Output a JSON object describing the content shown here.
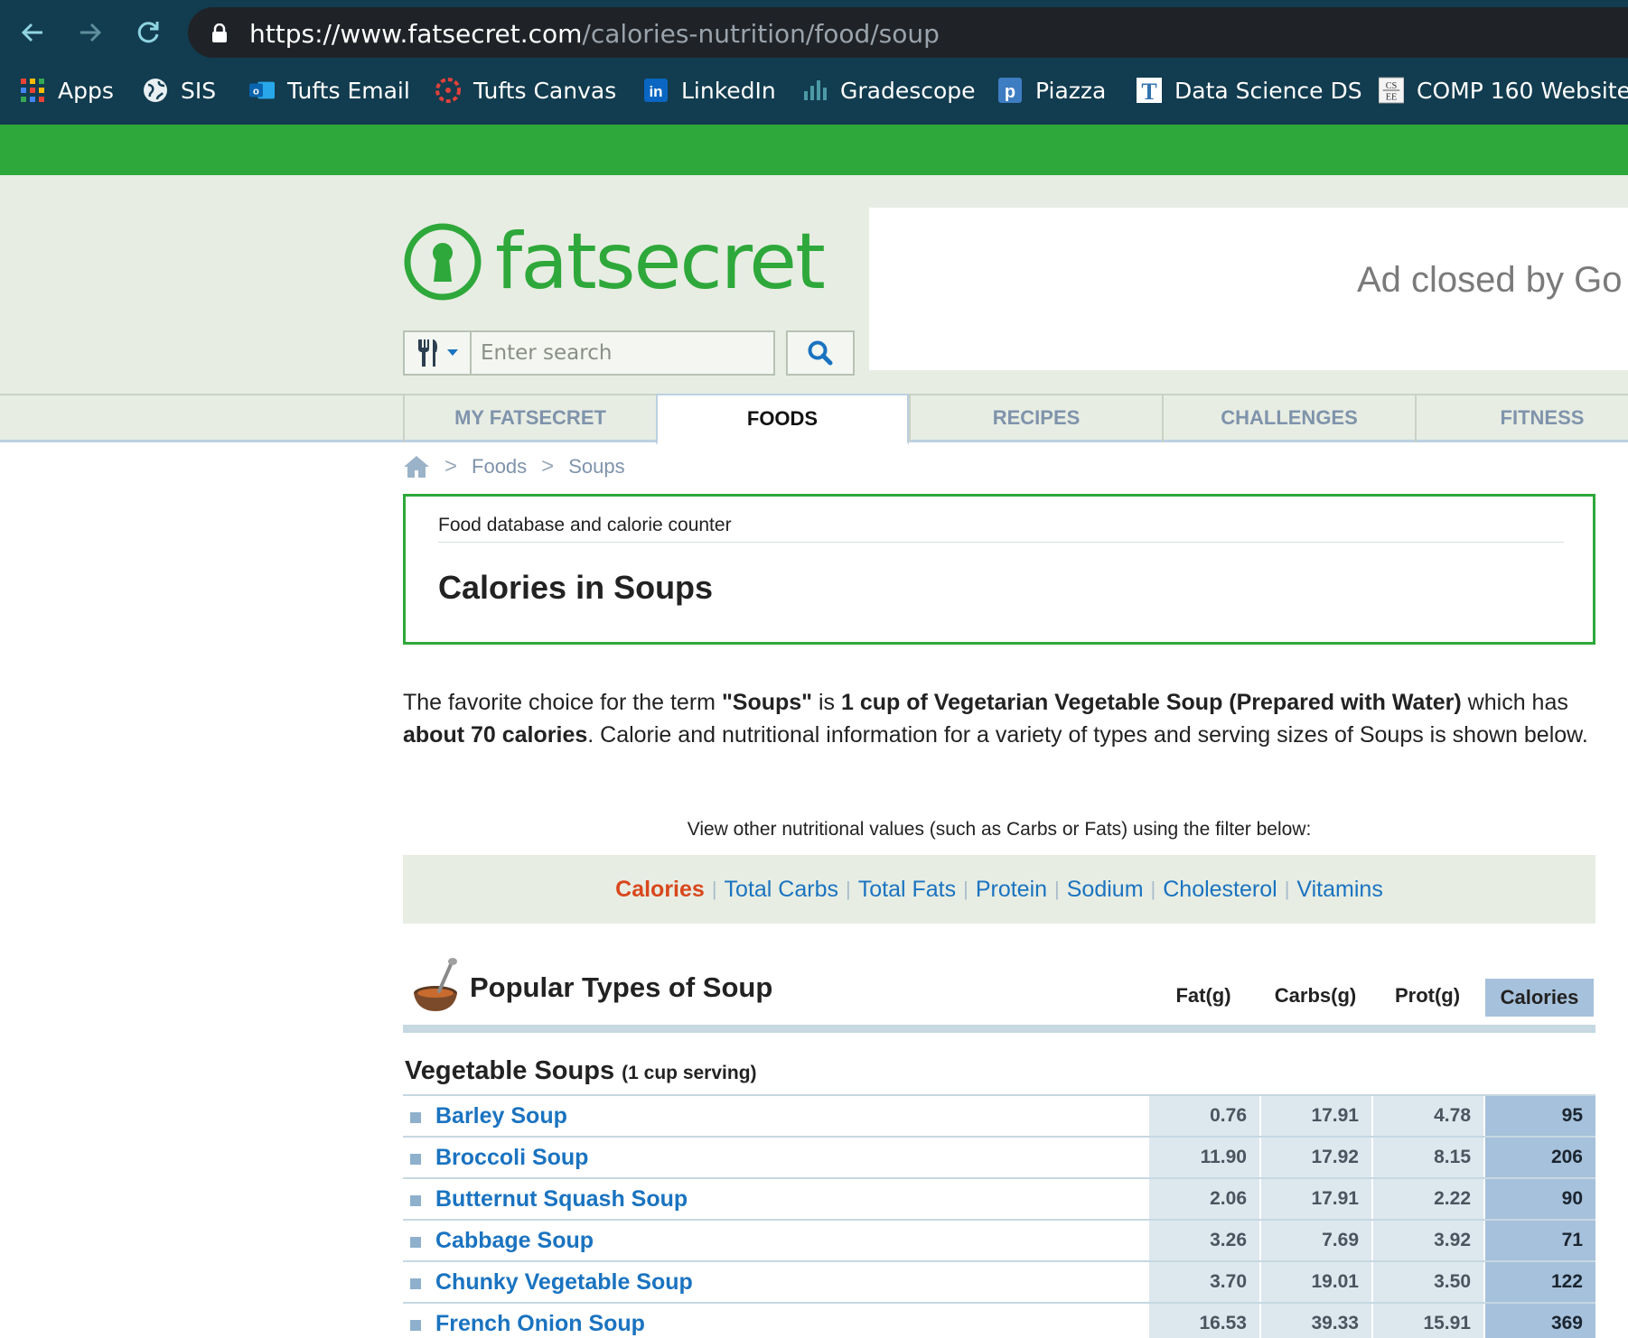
{
  "browser": {
    "url_host": "https://www.fatsecret.com",
    "url_path": "/calories-nutrition/food/soup",
    "bookmarks": [
      "Apps",
      "SIS",
      "Tufts Email",
      "Tufts Canvas",
      "LinkedIn",
      "Gradescope",
      "Piazza",
      "Data Science DS",
      "COMP 160 Website"
    ]
  },
  "site": {
    "logo_text": "fatsecret",
    "search_placeholder": "Enter search",
    "ad_text": "Ad closed by Go"
  },
  "tabs": [
    "MY FATSECRET",
    "FOODS",
    "RECIPES",
    "CHALLENGES",
    "FITNESS"
  ],
  "breadcrumb": [
    "Foods",
    "Soups"
  ],
  "title_box": {
    "subtitle": "Food database and calorie counter",
    "title": "Calories in Soups"
  },
  "intro": {
    "p1": "The favorite choice for the term ",
    "term": "\"Soups\"",
    "p2": " is ",
    "choice": "1 cup of Vegetarian Vegetable Soup (Prepared with Water)",
    "p3": " which has ",
    "calories": "about 70 calories",
    "p4": ". Calorie and nutritional information for a variety of types and serving sizes of Soups is shown below."
  },
  "filter": {
    "note": "View other nutritional values (such as Carbs or Fats) using the filter below:",
    "links": [
      "Calories",
      "Total Carbs",
      "Total Fats",
      "Protein",
      "Sodium",
      "Cholesterol",
      "Vitamins"
    ]
  },
  "table": {
    "section_title": "Popular Types of Soup",
    "columns": [
      "Fat(g)",
      "Carbs(g)",
      "Prot(g)",
      "Calories"
    ],
    "group_title": "Vegetable Soups",
    "group_serving": "(1 cup serving)",
    "rows": [
      {
        "name": "Barley Soup",
        "fat": "0.76",
        "carbs": "17.91",
        "prot": "4.78",
        "cal": "95"
      },
      {
        "name": "Broccoli Soup",
        "fat": "11.90",
        "carbs": "17.92",
        "prot": "8.15",
        "cal": "206"
      },
      {
        "name": "Butternut Squash Soup",
        "fat": "2.06",
        "carbs": "17.91",
        "prot": "2.22",
        "cal": "90"
      },
      {
        "name": "Cabbage Soup",
        "fat": "3.26",
        "carbs": "7.69",
        "prot": "3.92",
        "cal": "71"
      },
      {
        "name": "Chunky Vegetable Soup",
        "fat": "3.70",
        "carbs": "19.01",
        "prot": "3.50",
        "cal": "122"
      },
      {
        "name": "French Onion Soup",
        "fat": "16.53",
        "carbs": "39.33",
        "prot": "15.91",
        "cal": "369"
      }
    ]
  }
}
